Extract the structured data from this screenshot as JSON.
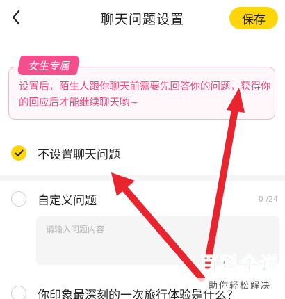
{
  "header": {
    "title": "聊天问题设置",
    "save_label": "保存",
    "back_icon": "chevron-left-icon"
  },
  "notice": {
    "badge": "女生专属",
    "text": "设置后，陌生人跟你聊天前需要先回答你的问题，获得你的回应后才能继续聊天哟~"
  },
  "options": [
    {
      "label": "不设置聊天问题",
      "checked": true
    },
    {
      "label": "自定义问题",
      "checked": false
    },
    {
      "label": "你印象最深刻的一次旅行体验是什么？",
      "checked": false
    }
  ],
  "custom_question": {
    "placeholder": "请输入问题内容",
    "counter": "0 /24"
  },
  "watermark": {
    "title": "百科全说",
    "subtitle": "助你轻松解决"
  },
  "colors": {
    "accent_yellow": "#ffd60a",
    "notice_pink": "#f2457f",
    "arrow_red": "#e8242f",
    "watermark_green": "#1fa03c"
  }
}
